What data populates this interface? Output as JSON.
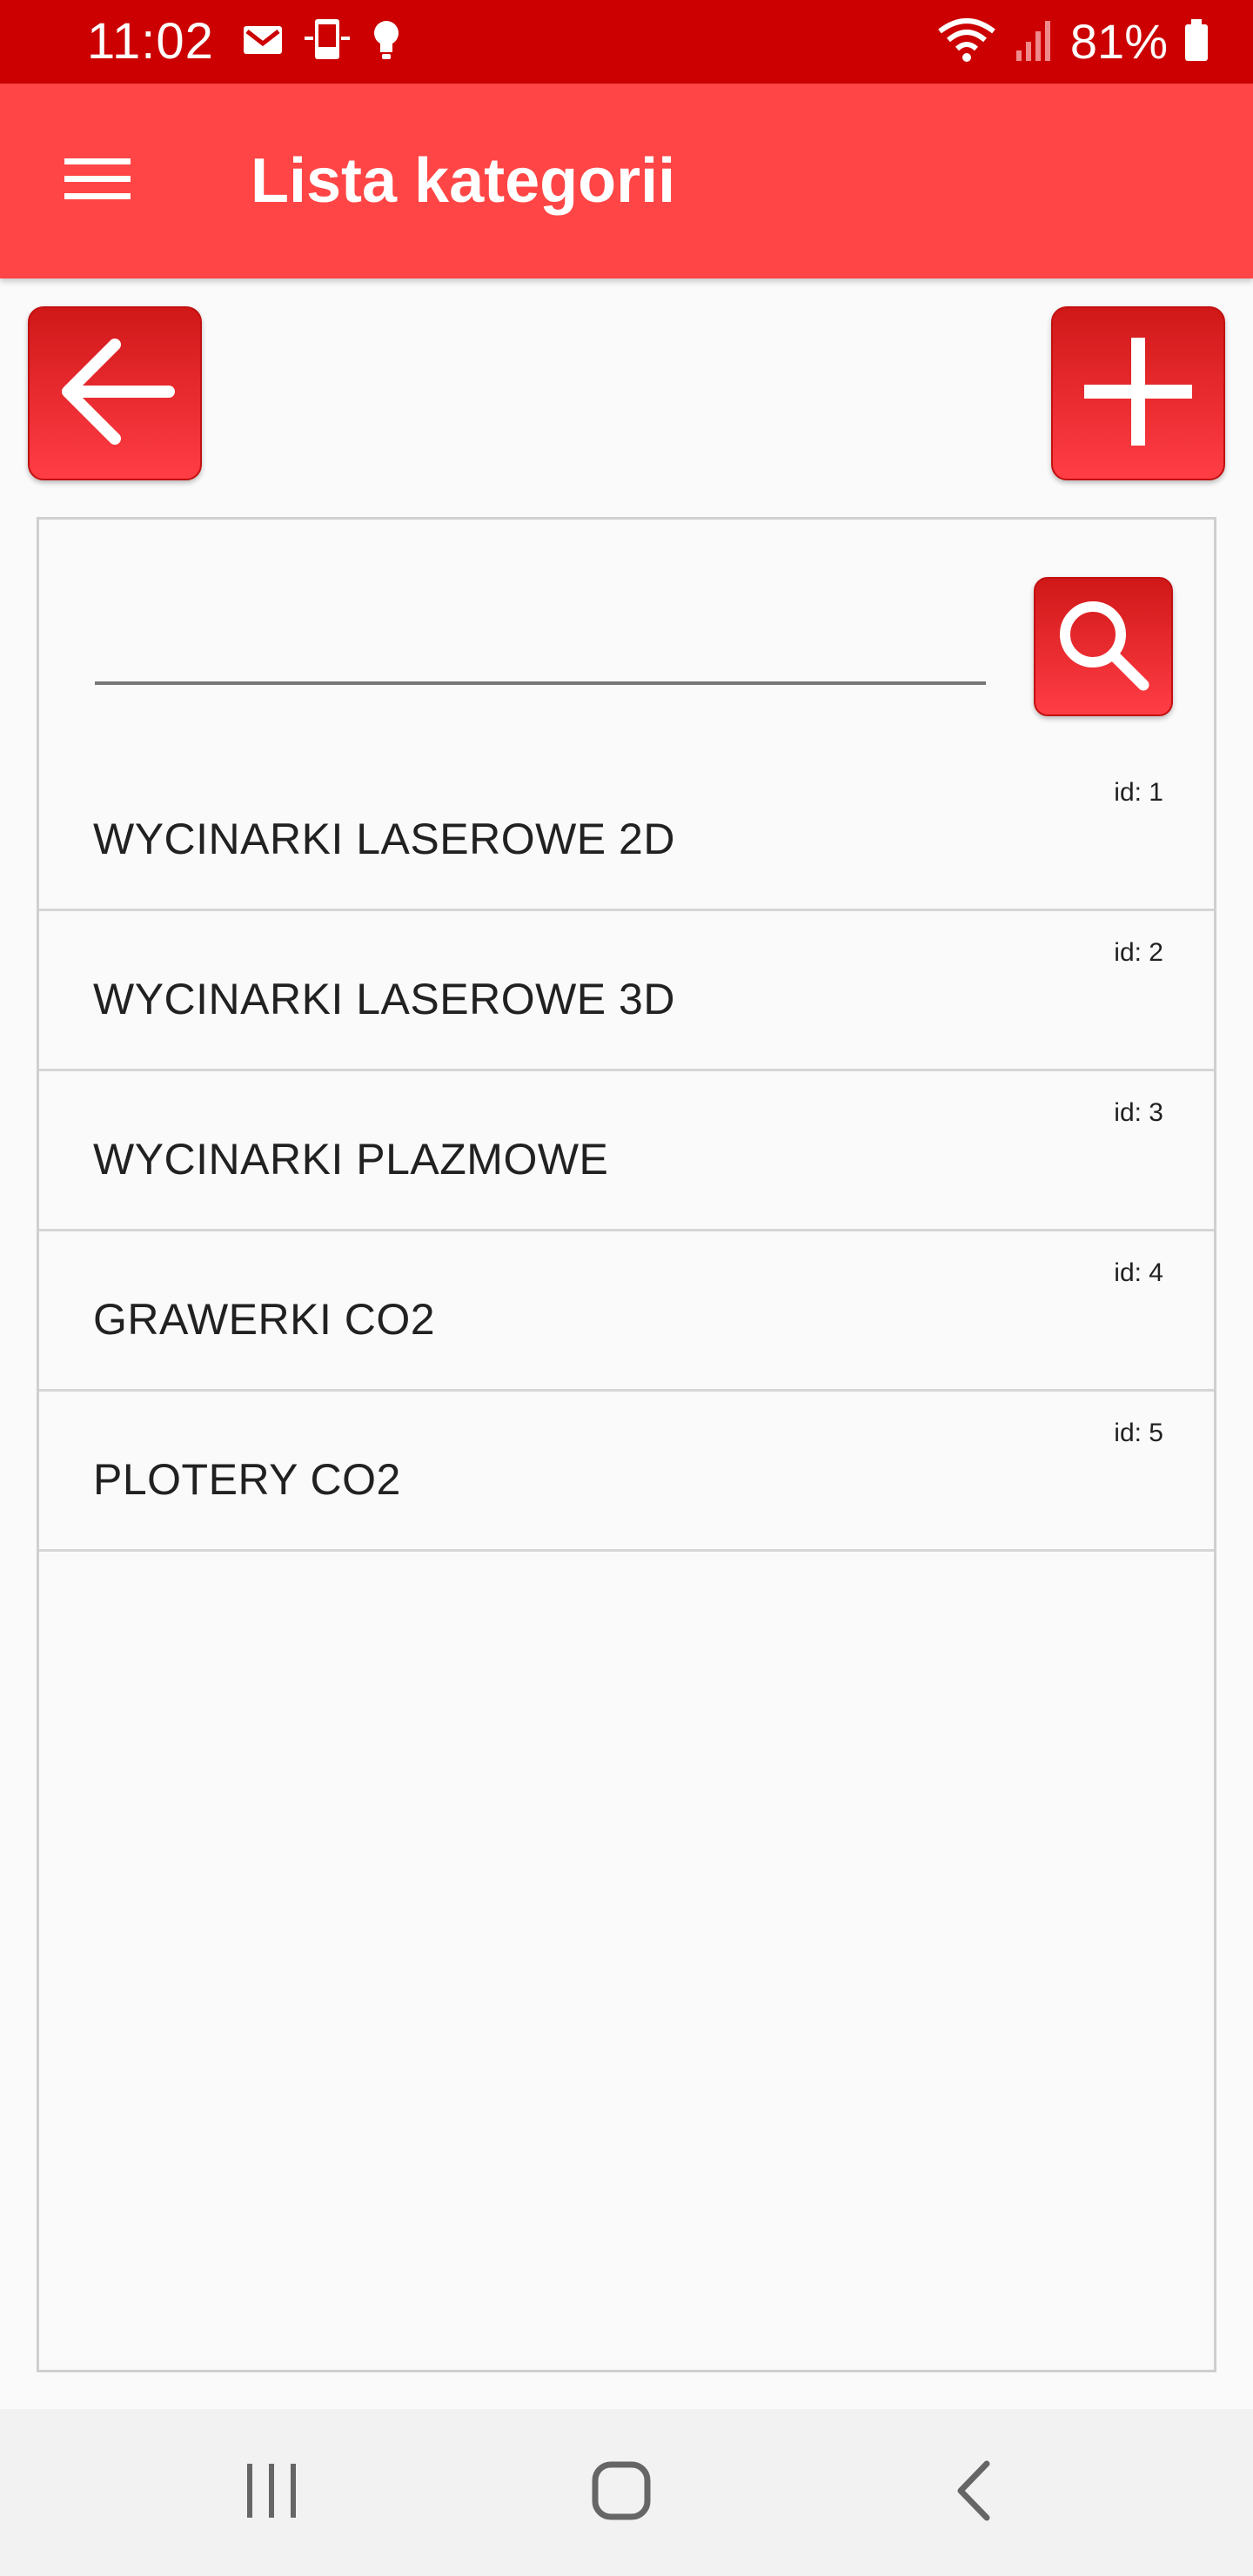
{
  "status_bar": {
    "time": "11:02",
    "battery_percent": "81%",
    "left_icons": [
      "gmail-icon",
      "phone-sync-icon",
      "lightbulb-icon"
    ],
    "right_icons": [
      "wifi-icon",
      "signal-icon",
      "battery-icon"
    ]
  },
  "app_bar": {
    "title": "Lista kategorii",
    "menu_icon": "hamburger-menu-icon",
    "background_color": "#ff4545"
  },
  "toolbar": {
    "back_icon": "arrow-left-icon",
    "add_icon": "plus-icon",
    "button_color": "#e8202a"
  },
  "search": {
    "value": "",
    "placeholder": "",
    "search_icon": "magnifier-icon"
  },
  "categories": [
    {
      "id_label": "id: 1",
      "name": "WYCINARKI LASEROWE 2D"
    },
    {
      "id_label": "id: 2",
      "name": "WYCINARKI LASEROWE 3D"
    },
    {
      "id_label": "id: 3",
      "name": "WYCINARKI PLAZMOWE"
    },
    {
      "id_label": "id: 4",
      "name": "GRAWERKI CO2"
    },
    {
      "id_label": "id: 5",
      "name": "PLOTERY CO2"
    }
  ],
  "nav_bar": {
    "icons": [
      "recents-icon",
      "home-icon",
      "back-chevron-icon"
    ]
  },
  "colors": {
    "status_bar": "#cc0000",
    "app_bar": "#ff4545",
    "background": "#fafafa",
    "text": "#212121"
  }
}
